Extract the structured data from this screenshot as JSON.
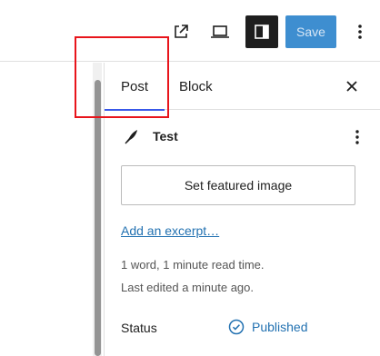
{
  "toolbar": {
    "external_icon": "external-link-icon",
    "preview_icon": "laptop-icon",
    "settings_icon": "sidebar-panel-icon",
    "save_label": "Save",
    "more_icon": "kebab-icon"
  },
  "sidebar": {
    "tabs": [
      {
        "label": "Post",
        "active": true
      },
      {
        "label": "Block",
        "active": false
      }
    ],
    "close_icon": "close-icon",
    "post": {
      "icon": "feather-icon",
      "title": "Test",
      "more_icon": "kebab-icon"
    },
    "featured_image_label": "Set featured image",
    "excerpt_link": "Add an excerpt…",
    "meta_line1": "1 word, 1 minute read time.",
    "meta_line2": "Last edited a minute ago.",
    "status": {
      "label": "Status",
      "value": "Published",
      "icon": "check-circle-icon"
    }
  },
  "colors": {
    "accent": "#3858e9",
    "link": "#2271b1",
    "save_bg": "#3e8ed0",
    "highlight": "#e8141b"
  }
}
